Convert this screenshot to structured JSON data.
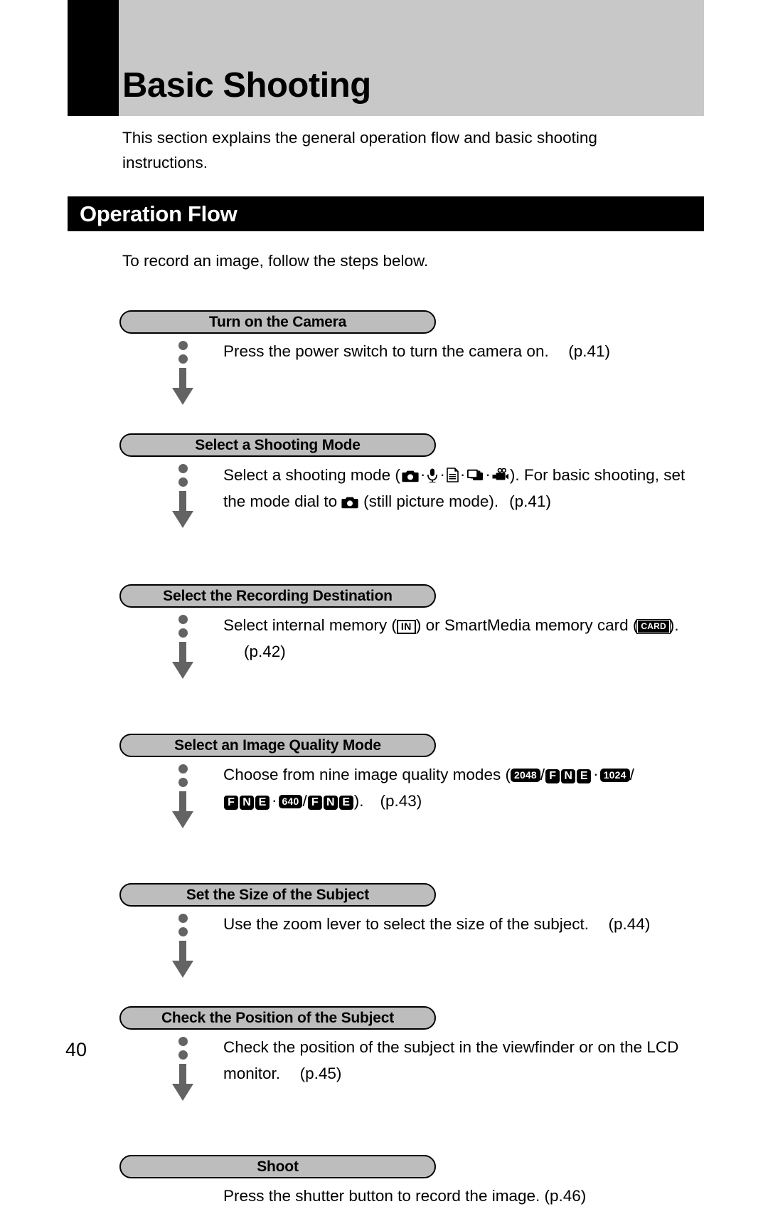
{
  "chapter": {
    "title": "Basic Shooting"
  },
  "intro": "This section explains the general operation flow and basic shooting instructions.",
  "section": {
    "title": "Operation Flow",
    "leadin": "To record an image, follow the steps below."
  },
  "flow": {
    "steps": [
      {
        "id": "turn-on-the-camera",
        "label": "Turn on the Camera",
        "text_before": "Press the power switch to turn the camera on.",
        "page_ref": "(p.41)"
      },
      {
        "id": "select-a-shooting-mode",
        "label": "Select a Shooting Mode",
        "text_1": "Select a shooting mode (",
        "icons_1": [
          "still-picture-icon",
          "voice-memo-icon",
          "text-mode-icon",
          "multi-shot-icon",
          "movie-icon"
        ],
        "text_2": "). For basic shooting, set the mode dial to",
        "icon_2": "still-picture-icon",
        "text_3": "(still picture mode).",
        "page_ref": "(p.41)"
      },
      {
        "id": "select-the-recording-destination",
        "label": "Select the Recording Destination",
        "text_1": "Select internal memory (",
        "badge_in": "IN",
        "text_2": ") or SmartMedia memory card (",
        "badge_card": "CARD",
        "text_3": ").",
        "page_ref": "(p.42)"
      },
      {
        "id": "select-an-image-quality-mode",
        "label": "Select an Image Quality Mode",
        "text_1": "Choose from nine image quality modes (",
        "res_1": "2048",
        "res_2": "1024",
        "res_3": "640",
        "quality_letters": [
          "F",
          "N",
          "E"
        ],
        "text_2": ").",
        "page_ref": "(p.43)"
      },
      {
        "id": "set-the-size-of-the-subject",
        "label": "Set the Size of the Subject",
        "text_before": "Use the zoom lever to select the size of the subject.",
        "page_ref": "(p.44)"
      },
      {
        "id": "check-the-position-of-the-subject",
        "label": "Check the Position of the Subject",
        "text_before": "Check the position of the subject in the viewfinder or on the LCD monitor.",
        "page_ref": "(p.45)"
      },
      {
        "id": "shoot",
        "label": "Shoot",
        "text_before": "Press the shutter button to record the image. (p.46)",
        "page_ref": ""
      }
    ],
    "connector_icon": "down-arrow-icon"
  },
  "page_number": "40",
  "colors": {
    "banner_gray": "#c8c8c8",
    "pill_gray": "#bdbdbd",
    "connector_gray": "#636363",
    "bar_black": "#000000",
    "text_black": "#000000"
  }
}
